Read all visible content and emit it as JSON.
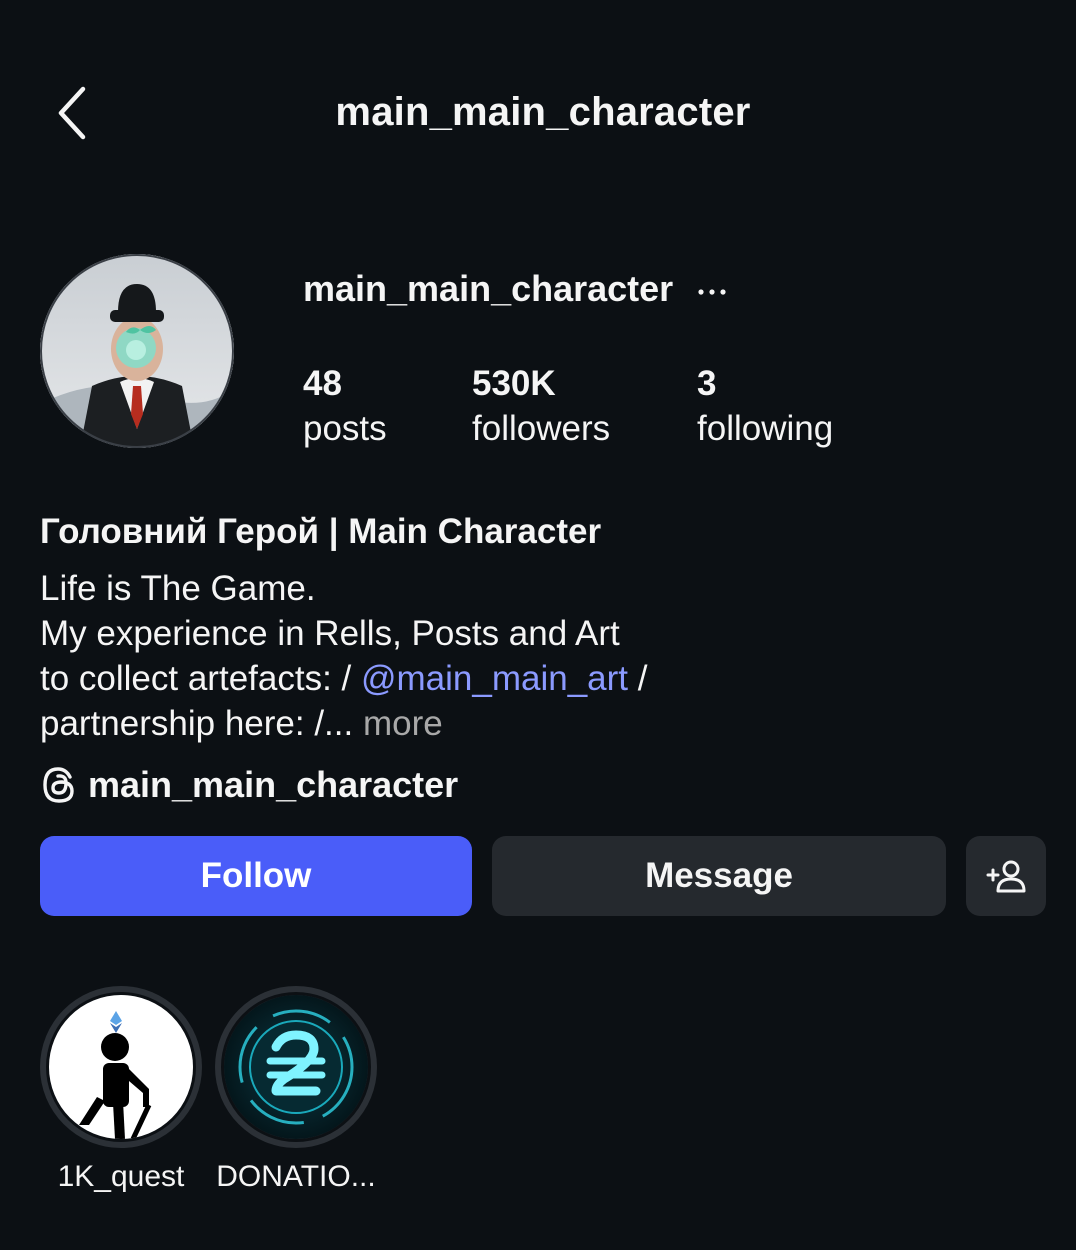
{
  "header": {
    "title": "main_main_character"
  },
  "profile": {
    "username": "main_main_character",
    "stats": [
      {
        "value": "48",
        "label": "posts"
      },
      {
        "value": "530K",
        "label": "followers"
      },
      {
        "value": "3",
        "label": "following"
      }
    ]
  },
  "bio": {
    "name": "Головний Герой | Main Character",
    "line1": "Life is The Game.",
    "line2": "My experience in Rells, Posts and Art",
    "line3_prefix": "to collect artefacts: / ",
    "line3_mention": "@main_main_art",
    "line3_suffix": " /",
    "line4": "partnership here: /... ",
    "more": "more"
  },
  "threads": {
    "username": "main_main_character",
    "icon": "threads-icon"
  },
  "actions": {
    "follow": "Follow",
    "message": "Message",
    "add_user_icon": "add-user-icon"
  },
  "highlights": [
    {
      "label": "1K_quest"
    },
    {
      "label": "DONATIO..."
    }
  ],
  "colors": {
    "background": "#0c1014",
    "follow_button": "#4a5df9",
    "secondary_button": "#25292e",
    "mention": "#8b9aff",
    "muted": "#a8a8a8"
  }
}
